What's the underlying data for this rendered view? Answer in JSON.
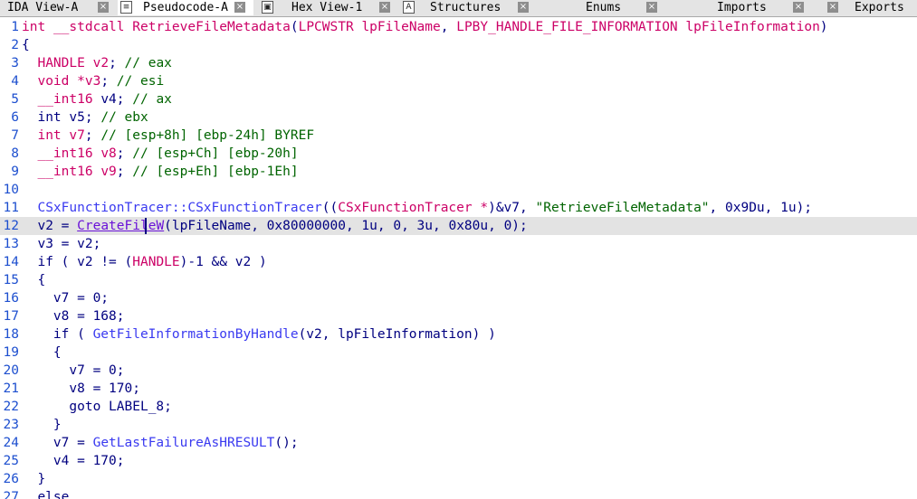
{
  "tabs": [
    {
      "label": "IDA View-A",
      "close": "×"
    },
    {
      "label": "Pseudocode-A",
      "close": "×",
      "icon": "≡"
    },
    {
      "label": "Hex View-1",
      "close": "×",
      "icon": "▣"
    },
    {
      "label": "Structures",
      "close": "×",
      "icon": "A"
    },
    {
      "label": "Enums",
      "close": "×"
    },
    {
      "label": "Imports",
      "close": "×"
    },
    {
      "label": "Exports",
      "close": "×"
    }
  ],
  "code": {
    "line_numbers": [
      "1",
      "2",
      "3",
      "4",
      "5",
      "6",
      "7",
      "8",
      "9",
      "10",
      "11",
      "12",
      "13",
      "14",
      "15",
      "16",
      "17",
      "18",
      "19",
      "20",
      "21",
      "22",
      "23",
      "24",
      "25",
      "26",
      "27"
    ],
    "l1": {
      "ret": "int",
      "cc": "__stdcall",
      "name": "RetrieveFileMetadata",
      "open": "(",
      "t1": "LPCWSTR",
      "a1": "lpFileName",
      "comma": ", ",
      "t2": "LPBY_HANDLE_FILE_INFORMATION",
      "a2": "lpFileInformation",
      "close": ")"
    },
    "l2": "{",
    "l3": {
      "type": "HANDLE",
      "var": "v2",
      "semi": "; ",
      "cmt": "// eax"
    },
    "l4": {
      "type": "void",
      "var": "*v3",
      "semi": "; ",
      "cmt": "// esi"
    },
    "l5": {
      "type": "__int16",
      "var": "v4",
      "semi": "; ",
      "cmt": "// ax"
    },
    "l6": {
      "type": "int",
      "var": "v5",
      "semi": "; ",
      "cmt": "// ebx"
    },
    "l7": {
      "type": "int",
      "var": "v7",
      "semi": "; ",
      "cmt": "// [esp+8h] [ebp-24h] BYREF"
    },
    "l8": {
      "type": "__int16",
      "var": "v8",
      "semi": "; ",
      "cmt": "// [esp+Ch] [ebp-20h]"
    },
    "l9": {
      "type": "__int16",
      "var": "v9",
      "semi": "; ",
      "cmt": "// [esp+Eh] [ebp-1Eh]"
    },
    "l10": "",
    "l11": {
      "fn": "CSxFunctionTracer::CSxFunctionTracer",
      "open": "((",
      "cast": "CSxFunctionTracer *",
      "mid": ")&v7, ",
      "str": "\"RetrieveFileMetadata\"",
      "rest": ", 0x9Du, 1u);"
    },
    "l12": {
      "lhs": "v2",
      "eq": " = ",
      "fn": "CreateFileW",
      "open": "(",
      "arg": "lpFileName",
      "rest": ", 0x80000000, 1u, 0, 3u, 0x80u, 0);"
    },
    "l13": "v3 = v2;",
    "l14": {
      "a": "if ( ",
      "v": "v2",
      "b": " != (",
      "h": "HANDLE",
      "c": ")-1 && ",
      "v2": "v2",
      "d": " )"
    },
    "l15": "{",
    "l16": "v7 = 0;",
    "l17": "v8 = 168;",
    "l18": {
      "a": "if ( ",
      "fn": "GetFileInformationByHandle",
      "b": "(v2, lpFileInformation) )"
    },
    "l19": "{",
    "l20": "v7 = 0;",
    "l21": "v8 = 170;",
    "l22": "goto LABEL_8;",
    "l23": "}",
    "l24": {
      "lhs": "v7",
      "eq": " = ",
      "fn": "GetLastFailureAsHRESULT",
      "rest": "();"
    },
    "l25": "v4 = 170;",
    "l26": "}",
    "l27": "else"
  }
}
